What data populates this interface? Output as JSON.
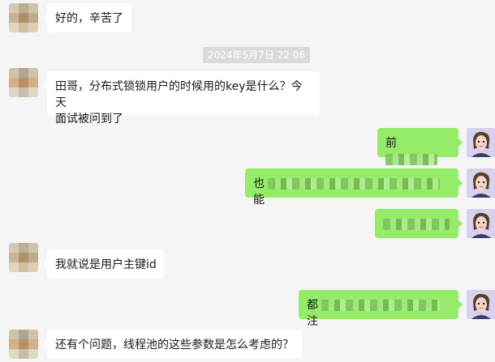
{
  "messages": [
    {
      "sender": "other",
      "text": "好的，辛苦了"
    },
    {
      "type": "timestamp",
      "text": "2024年5月7日 22:06"
    },
    {
      "sender": "other",
      "line1": "田哥，分布式锁锁用户的时候用的key是什么？今天",
      "line2": "面试被问到了"
    },
    {
      "sender": "me",
      "visible_prefix": "前"
    },
    {
      "sender": "me",
      "visible_prefix": "也",
      "visible_suffix": "能"
    },
    {
      "sender": "me",
      "visible_prefix": ""
    },
    {
      "sender": "other",
      "text": "我就说是用户主键id"
    },
    {
      "sender": "me",
      "visible_prefix": "都",
      "visible_suffix": "注"
    },
    {
      "sender": "other",
      "text": "还有个问题，线程池的这些参数是怎么考虑的？"
    }
  ],
  "colors": {
    "background": "#f5f5f5",
    "incoming_bubble": "#ffffff",
    "outgoing_bubble": "#95ec69",
    "timestamp_bg": "#dadada"
  }
}
